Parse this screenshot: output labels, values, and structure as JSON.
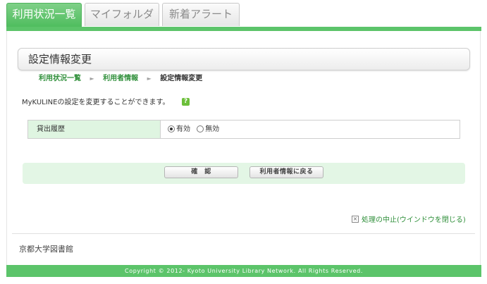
{
  "tabs": [
    {
      "label": "利用状況一覧",
      "active": true
    },
    {
      "label": "マイフォルダ",
      "active": false
    },
    {
      "label": "新着アラート",
      "active": false
    }
  ],
  "page": {
    "title": "設定情報変更"
  },
  "breadcrumb": {
    "items": [
      "利用状況一覧",
      "利用者情報"
    ],
    "current": "設定情報変更",
    "separator": "►"
  },
  "description": "MyKULINEの設定を変更することができます。",
  "help_icon": "?",
  "settings": {
    "label": "貸出履歴",
    "options": [
      {
        "label": "有効",
        "checked": true
      },
      {
        "label": "無効",
        "checked": false
      }
    ]
  },
  "buttons": {
    "confirm": "確　認",
    "back": "利用者情報に戻る"
  },
  "cancel_link": "処理の中止(ウインドウを閉じる)",
  "library_name": "京都大学図書館",
  "footer": "Copyright © 2012- Kyoto University Library Network. All Rights Reserved.",
  "colors": {
    "accent": "#5cc46a",
    "link": "#2f8f3a",
    "label_bg": "#dff5e1"
  }
}
